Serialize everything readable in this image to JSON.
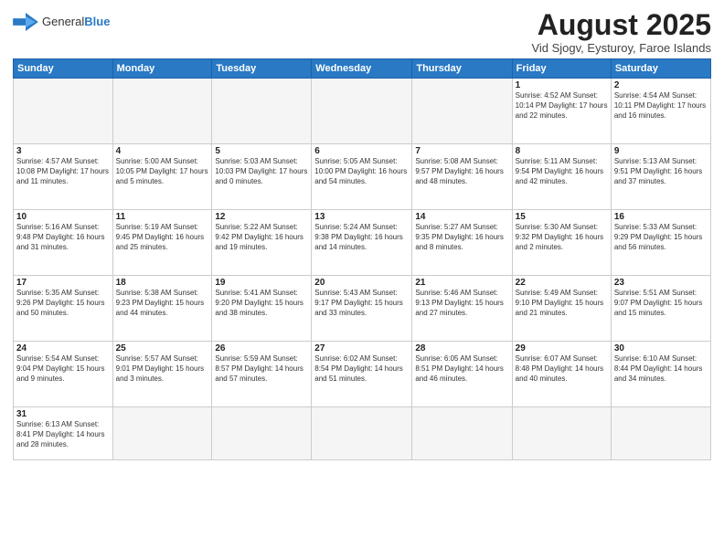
{
  "logo": {
    "text_general": "General",
    "text_blue": "Blue"
  },
  "title": "August 2025",
  "subtitle": "Vid Sjogv, Eysturoy, Faroe Islands",
  "days_of_week": [
    "Sunday",
    "Monday",
    "Tuesday",
    "Wednesday",
    "Thursday",
    "Friday",
    "Saturday"
  ],
  "weeks": [
    [
      {
        "day": "",
        "info": ""
      },
      {
        "day": "",
        "info": ""
      },
      {
        "day": "",
        "info": ""
      },
      {
        "day": "",
        "info": ""
      },
      {
        "day": "",
        "info": ""
      },
      {
        "day": "1",
        "info": "Sunrise: 4:52 AM\nSunset: 10:14 PM\nDaylight: 17 hours\nand 22 minutes."
      },
      {
        "day": "2",
        "info": "Sunrise: 4:54 AM\nSunset: 10:11 PM\nDaylight: 17 hours\nand 16 minutes."
      }
    ],
    [
      {
        "day": "3",
        "info": "Sunrise: 4:57 AM\nSunset: 10:08 PM\nDaylight: 17 hours\nand 11 minutes."
      },
      {
        "day": "4",
        "info": "Sunrise: 5:00 AM\nSunset: 10:05 PM\nDaylight: 17 hours\nand 5 minutes."
      },
      {
        "day": "5",
        "info": "Sunrise: 5:03 AM\nSunset: 10:03 PM\nDaylight: 17 hours\nand 0 minutes."
      },
      {
        "day": "6",
        "info": "Sunrise: 5:05 AM\nSunset: 10:00 PM\nDaylight: 16 hours\nand 54 minutes."
      },
      {
        "day": "7",
        "info": "Sunrise: 5:08 AM\nSunset: 9:57 PM\nDaylight: 16 hours\nand 48 minutes."
      },
      {
        "day": "8",
        "info": "Sunrise: 5:11 AM\nSunset: 9:54 PM\nDaylight: 16 hours\nand 42 minutes."
      },
      {
        "day": "9",
        "info": "Sunrise: 5:13 AM\nSunset: 9:51 PM\nDaylight: 16 hours\nand 37 minutes."
      }
    ],
    [
      {
        "day": "10",
        "info": "Sunrise: 5:16 AM\nSunset: 9:48 PM\nDaylight: 16 hours\nand 31 minutes."
      },
      {
        "day": "11",
        "info": "Sunrise: 5:19 AM\nSunset: 9:45 PM\nDaylight: 16 hours\nand 25 minutes."
      },
      {
        "day": "12",
        "info": "Sunrise: 5:22 AM\nSunset: 9:42 PM\nDaylight: 16 hours\nand 19 minutes."
      },
      {
        "day": "13",
        "info": "Sunrise: 5:24 AM\nSunset: 9:38 PM\nDaylight: 16 hours\nand 14 minutes."
      },
      {
        "day": "14",
        "info": "Sunrise: 5:27 AM\nSunset: 9:35 PM\nDaylight: 16 hours\nand 8 minutes."
      },
      {
        "day": "15",
        "info": "Sunrise: 5:30 AM\nSunset: 9:32 PM\nDaylight: 16 hours\nand 2 minutes."
      },
      {
        "day": "16",
        "info": "Sunrise: 5:33 AM\nSunset: 9:29 PM\nDaylight: 15 hours\nand 56 minutes."
      }
    ],
    [
      {
        "day": "17",
        "info": "Sunrise: 5:35 AM\nSunset: 9:26 PM\nDaylight: 15 hours\nand 50 minutes."
      },
      {
        "day": "18",
        "info": "Sunrise: 5:38 AM\nSunset: 9:23 PM\nDaylight: 15 hours\nand 44 minutes."
      },
      {
        "day": "19",
        "info": "Sunrise: 5:41 AM\nSunset: 9:20 PM\nDaylight: 15 hours\nand 38 minutes."
      },
      {
        "day": "20",
        "info": "Sunrise: 5:43 AM\nSunset: 9:17 PM\nDaylight: 15 hours\nand 33 minutes."
      },
      {
        "day": "21",
        "info": "Sunrise: 5:46 AM\nSunset: 9:13 PM\nDaylight: 15 hours\nand 27 minutes."
      },
      {
        "day": "22",
        "info": "Sunrise: 5:49 AM\nSunset: 9:10 PM\nDaylight: 15 hours\nand 21 minutes."
      },
      {
        "day": "23",
        "info": "Sunrise: 5:51 AM\nSunset: 9:07 PM\nDaylight: 15 hours\nand 15 minutes."
      }
    ],
    [
      {
        "day": "24",
        "info": "Sunrise: 5:54 AM\nSunset: 9:04 PM\nDaylight: 15 hours\nand 9 minutes."
      },
      {
        "day": "25",
        "info": "Sunrise: 5:57 AM\nSunset: 9:01 PM\nDaylight: 15 hours\nand 3 minutes."
      },
      {
        "day": "26",
        "info": "Sunrise: 5:59 AM\nSunset: 8:57 PM\nDaylight: 14 hours\nand 57 minutes."
      },
      {
        "day": "27",
        "info": "Sunrise: 6:02 AM\nSunset: 8:54 PM\nDaylight: 14 hours\nand 51 minutes."
      },
      {
        "day": "28",
        "info": "Sunrise: 6:05 AM\nSunset: 8:51 PM\nDaylight: 14 hours\nand 46 minutes."
      },
      {
        "day": "29",
        "info": "Sunrise: 6:07 AM\nSunset: 8:48 PM\nDaylight: 14 hours\nand 40 minutes."
      },
      {
        "day": "30",
        "info": "Sunrise: 6:10 AM\nSunset: 8:44 PM\nDaylight: 14 hours\nand 34 minutes."
      }
    ],
    [
      {
        "day": "31",
        "info": "Sunrise: 6:13 AM\nSunset: 8:41 PM\nDaylight: 14 hours\nand 28 minutes."
      },
      {
        "day": "",
        "info": ""
      },
      {
        "day": "",
        "info": ""
      },
      {
        "day": "",
        "info": ""
      },
      {
        "day": "",
        "info": ""
      },
      {
        "day": "",
        "info": ""
      },
      {
        "day": "",
        "info": ""
      }
    ]
  ]
}
